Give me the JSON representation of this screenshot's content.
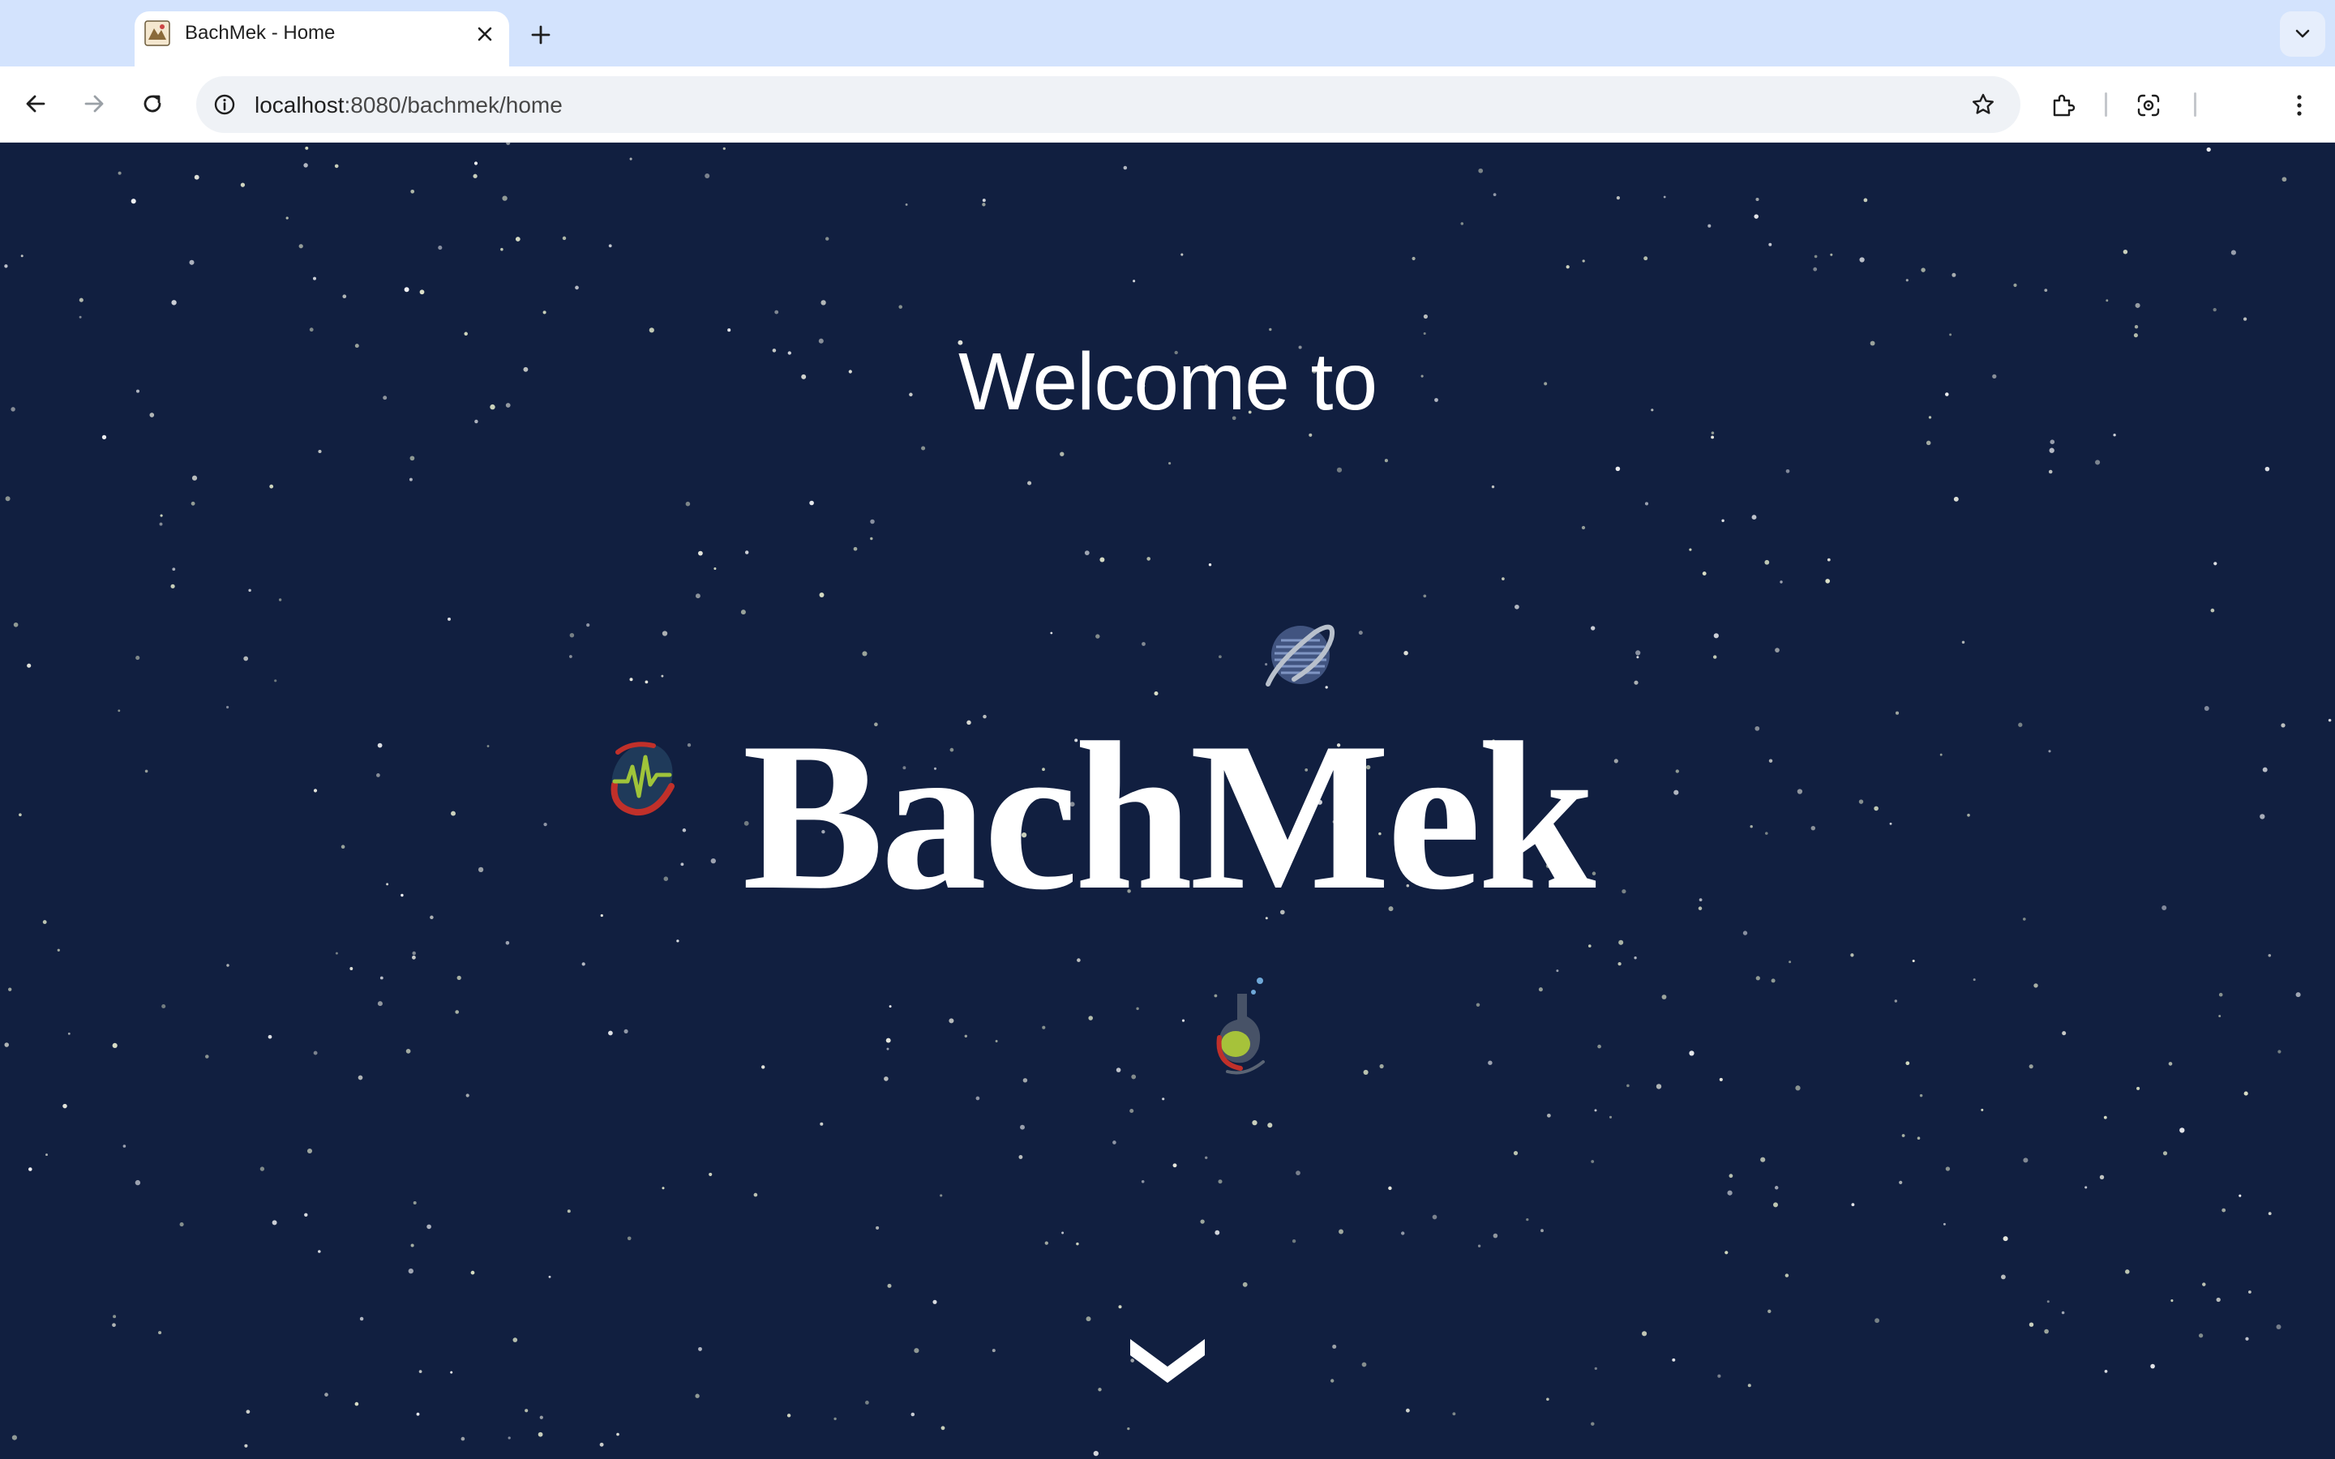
{
  "browser": {
    "tab": {
      "title": "BachMek - Home",
      "favicon": "bachmek-favicon-icon"
    },
    "address_bar": {
      "host": "localhost",
      "path": ":8080/bachmek/home"
    },
    "toolbar_icons": [
      "back-icon",
      "forward-icon",
      "reload-icon",
      "site-info-icon",
      "bookmark-star-icon",
      "extensions-icon",
      "google-lens-icon",
      "more-menu-icon"
    ]
  },
  "hero": {
    "welcome_text": "Welcome to",
    "brand_name": "BachMek",
    "decorations": [
      "globe-planet-icon",
      "heartbeat-planet-icon",
      "flask-planet-icon"
    ],
    "scroll_icon": "chevron-down-icon"
  },
  "colors": {
    "page_background": "#111f40",
    "text": "#ffffff",
    "tabstrip": "#d3e3fd"
  }
}
